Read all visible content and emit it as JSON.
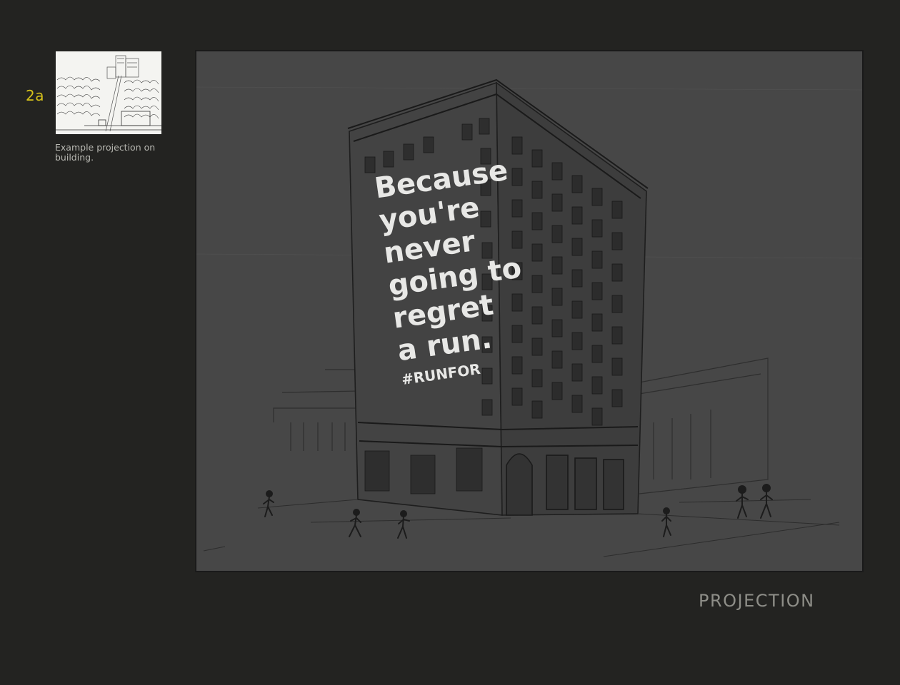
{
  "slide": {
    "number": "2a",
    "caption": "Example projection on building.",
    "section_title": "PROJECTION"
  },
  "projection": {
    "lines": [
      "Because",
      "you're",
      "never",
      "going to",
      "regret",
      "a run."
    ],
    "hashtag": "#RUNFOR"
  },
  "colors": {
    "background": "#232321",
    "accent": "#d6c21a",
    "sketch_bg": "#474747",
    "caption": "#b8b8b2",
    "title": "#8e8e88"
  }
}
